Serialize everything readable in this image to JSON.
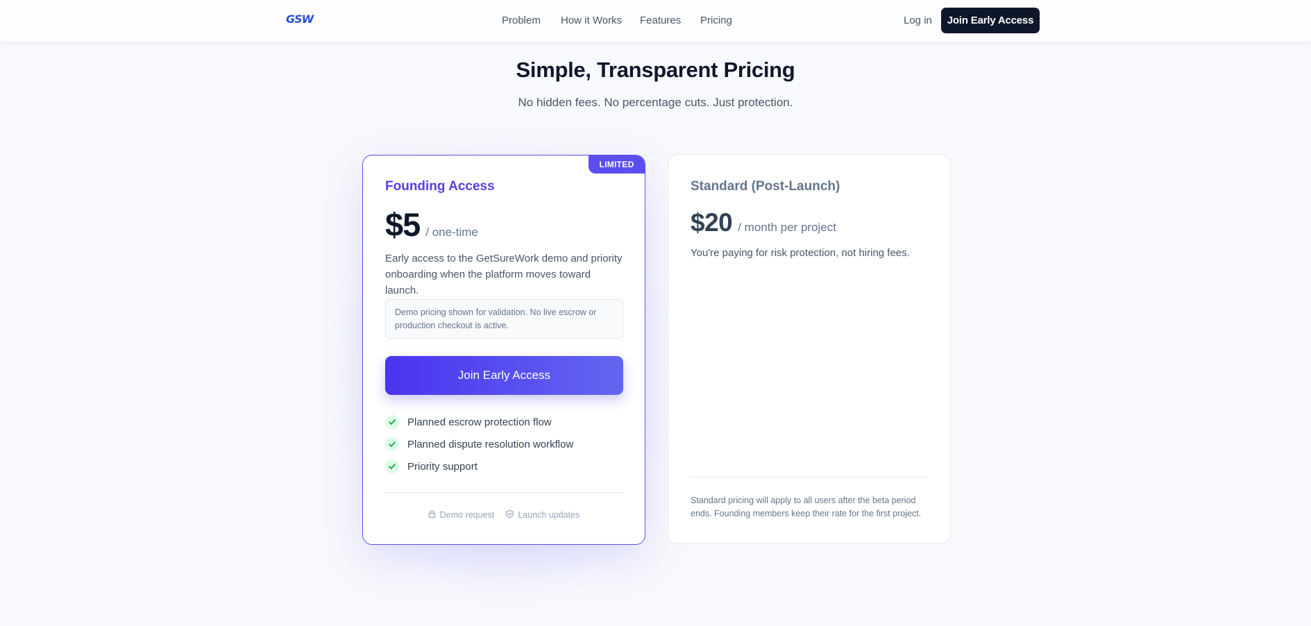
{
  "nav": {
    "logo": "GSW",
    "links": [
      "Problem",
      "How it Works",
      "Features",
      "Pricing"
    ],
    "login": "Log in",
    "cta": "Join Early Access"
  },
  "header": {
    "title": "Simple, Transparent Pricing",
    "subtitle": "No hidden fees. No percentage cuts. Just protection."
  },
  "plans": [
    {
      "badge": "LIMITED",
      "name": "Founding Access",
      "price": "$5",
      "period": "/ one-time",
      "description": "Early access to the GetSureWork demo and priority onboarding when the platform moves toward launch.",
      "note": "Demo pricing shown for validation. No live escrow or production checkout is active.",
      "cta": "Join Early Access",
      "features": [
        "Planned escrow protection flow",
        "Planned dispute resolution workflow",
        "Priority support"
      ],
      "footer": [
        "Demo request",
        "Launch updates"
      ]
    },
    {
      "name": "Standard (Post-Launch)",
      "price": "$20",
      "period": "/ month per project",
      "description": "You're paying for risk protection, not hiring fees.",
      "fine_print": "Standard pricing will apply to all users after the beta period ends. Founding members keep their rate for the first project."
    }
  ]
}
